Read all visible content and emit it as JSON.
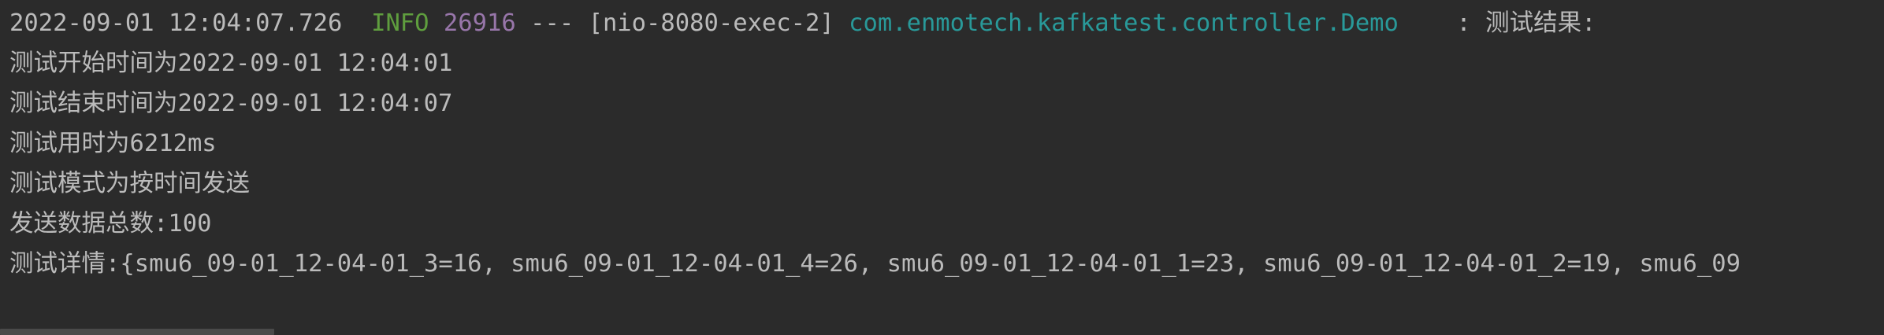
{
  "log": {
    "header": {
      "timestamp": "2022-09-01 12:04:07.726",
      "level": "INFO",
      "pid": "26916",
      "separator": "---",
      "thread": "[nio-8080-exec-2]",
      "logger": "com.enmotech.kafkatest.controller.Demo",
      "message": ": 测试结果:"
    },
    "lines": [
      "测试开始时间为2022-09-01 12:04:01",
      "测试结束时间为2022-09-01 12:04:07",
      "测试用时为6212ms",
      "测试模式为按时间发送",
      "发送数据总数:100",
      "测试详情:{smu6_09-01_12-04-01_3=16, smu6_09-01_12-04-01_4=26, smu6_09-01_12-04-01_1=23, smu6_09-01_12-04-01_2=19, smu6_09"
    ]
  },
  "colors": {
    "background": "#2b2b2b",
    "text": "#bbbbbb",
    "info": "#5f9e3e",
    "pid": "#9876aa",
    "logger": "#299999"
  }
}
